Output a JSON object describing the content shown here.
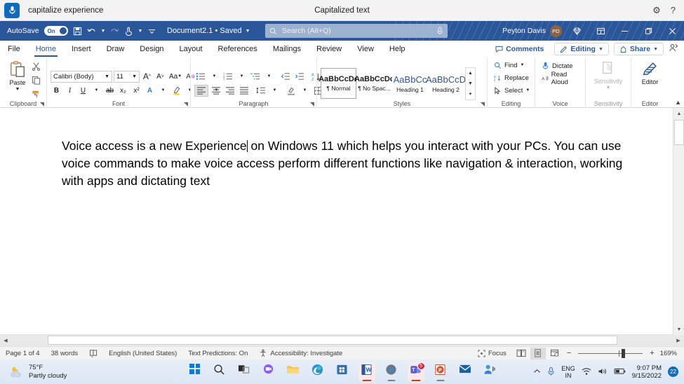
{
  "voice_access": {
    "mic_icon": "microphone-icon",
    "command_text": "capitalize experience",
    "status_text": "Capitalized text",
    "settings_icon": "gear-icon",
    "help_icon": "help-icon"
  },
  "titlebar": {
    "autosave_label": "AutoSave",
    "autosave_state": "On",
    "save_icon": "save-icon",
    "undo_icon": "undo-icon",
    "redo_icon": "redo-icon",
    "touch_icon": "touch-mode-icon",
    "customize_icon": "customize-qat-icon",
    "document_name": "Document2.1 • Saved",
    "search_placeholder": "Search (Alt+Q)",
    "search_icon": "search-icon",
    "search_mic_icon": "microphone-icon",
    "user_name": "Peyton Davis",
    "user_initials": "PD",
    "diamond_icon": "diamond-icon",
    "ribbon_display_icon": "ribbon-display-options-icon",
    "minimize_icon": "minimize-icon",
    "restore_icon": "restore-icon",
    "close_icon": "close-icon"
  },
  "ribbon": {
    "tabs": [
      {
        "label": "File",
        "active": false
      },
      {
        "label": "Home",
        "active": true
      },
      {
        "label": "Insert",
        "active": false
      },
      {
        "label": "Draw",
        "active": false
      },
      {
        "label": "Design",
        "active": false
      },
      {
        "label": "Layout",
        "active": false
      },
      {
        "label": "References",
        "active": false
      },
      {
        "label": "Mailings",
        "active": false
      },
      {
        "label": "Review",
        "active": false
      },
      {
        "label": "View",
        "active": false
      },
      {
        "label": "Help",
        "active": false
      }
    ],
    "comments_label": "Comments",
    "editing_label": "Editing",
    "share_label": "Share",
    "catchup_icon": "catch-up-icon",
    "collapse_icon": "collapse-ribbon-icon",
    "groups": {
      "clipboard": {
        "label": "Clipboard",
        "paste_label": "Paste",
        "cut_icon": "cut-icon",
        "copy_icon": "copy-icon",
        "format_painter_icon": "format-painter-icon"
      },
      "font": {
        "label": "Font",
        "font_name": "Calibri (Body)",
        "font_size": "11",
        "grow_icon": "increase-font-size-icon",
        "shrink_icon": "decrease-font-size-icon",
        "change_case_icon": "change-case-icon",
        "clear_formatting_icon": "clear-formatting-icon",
        "bold_label": "B",
        "italic_label": "I",
        "underline_label": "U",
        "strikethrough_icon": "strikethrough-icon",
        "subscript_label": "x₂",
        "superscript_label": "x²",
        "text_effects_icon": "text-effects-icon",
        "highlight_icon": "text-highlight-color-icon",
        "font_color_icon": "font-color-icon"
      },
      "paragraph": {
        "label": "Paragraph",
        "bullets_icon": "bullets-icon",
        "numbering_icon": "numbering-icon",
        "multilevel_icon": "multilevel-list-icon",
        "decrease_indent_icon": "decrease-indent-icon",
        "increase_indent_icon": "increase-indent-icon",
        "sort_icon": "sort-icon",
        "show_marks_icon": "show-formatting-marks-icon",
        "align_left_icon": "align-left-icon",
        "align_center_icon": "align-center-icon",
        "align_right_icon": "align-right-icon",
        "justify_icon": "justify-icon",
        "line_spacing_icon": "line-spacing-icon",
        "shading_icon": "shading-icon",
        "borders_icon": "borders-icon"
      },
      "styles": {
        "label": "Styles",
        "items": [
          {
            "preview": "AaBbCcDc",
            "name": "¶ Normal",
            "selected": true,
            "heading": false
          },
          {
            "preview": "AaBbCcDc",
            "name": "¶ No Spac...",
            "selected": false,
            "heading": false
          },
          {
            "preview": "AaBbCc",
            "name": "Heading 1",
            "selected": false,
            "heading": true
          },
          {
            "preview": "AaBbCcD",
            "name": "Heading 2",
            "selected": false,
            "heading": true
          }
        ],
        "scroll_up_icon": "scroll-up-icon",
        "scroll_down_icon": "scroll-down-icon",
        "more_icon": "more-styles-icon"
      },
      "editing": {
        "label": "Editing",
        "find_label": "Find",
        "replace_label": "Replace",
        "select_label": "Select",
        "find_icon": "find-icon",
        "replace_icon": "replace-icon",
        "select_icon": "select-icon"
      },
      "voice": {
        "label": "Voice",
        "dictate_label": "Dictate",
        "read_aloud_label": "Read Aloud",
        "dictate_icon": "microphone-icon",
        "read_aloud_icon": "read-aloud-icon"
      },
      "sensitivity": {
        "label": "Sensitivity",
        "button_label": "Sensitivity",
        "icon": "sensitivity-icon"
      },
      "editor": {
        "label": "Editor",
        "button_label": "Editor",
        "icon": "editor-pen-icon"
      }
    }
  },
  "document": {
    "paragraph_before_caret": "Voice access is a new Experience",
    "paragraph_after_caret": " on Windows 11 which helps you interact with your PCs. You can use voice commands to make voice access perform different functions like navigation & interaction, working with apps and dictating text"
  },
  "scrollbars": {
    "v_up_icon": "scroll-up-arrow-icon",
    "v_down_icon": "scroll-down-arrow-icon",
    "h_left_icon": "scroll-left-arrow-icon",
    "h_right_icon": "scroll-right-arrow-icon"
  },
  "statusbar": {
    "page": "Page 1 of 4",
    "words": "38 words",
    "proofing_icon": "proofing-errors-icon",
    "language": "English (United States)",
    "text_predictions": "Text Predictions: On",
    "accessibility": "Accessibility: Investigate",
    "accessibility_icon": "accessibility-icon",
    "focus_label": "Focus",
    "focus_icon": "focus-icon",
    "read_mode_icon": "read-mode-icon",
    "print_layout_icon": "print-layout-icon",
    "web_layout_icon": "web-layout-icon",
    "zoom_out_label": "−",
    "zoom_in_label": "+",
    "zoom_level": "169%"
  },
  "taskbar": {
    "weather_temp": "75°F",
    "weather_desc": "Partly cloudy",
    "weather_icon": "partly-cloudy-night-icon",
    "icons": [
      {
        "name": "start-button",
        "glyph": "windows-logo-icon"
      },
      {
        "name": "search-button",
        "glyph": "search-icon"
      },
      {
        "name": "task-view-button",
        "glyph": "task-view-icon"
      },
      {
        "name": "chat-button",
        "glyph": "chat-icon"
      },
      {
        "name": "file-explorer-button",
        "glyph": "folder-icon"
      },
      {
        "name": "edge-button",
        "glyph": "edge-icon"
      },
      {
        "name": "microsoft-store-button",
        "glyph": "store-icon"
      },
      {
        "name": "word-button",
        "glyph": "word-icon"
      },
      {
        "name": "settings-button",
        "glyph": "gear-icon"
      },
      {
        "name": "teams-button",
        "glyph": "teams-icon"
      },
      {
        "name": "powerpoint-button",
        "glyph": "powerpoint-icon"
      },
      {
        "name": "mail-button",
        "glyph": "mail-icon"
      },
      {
        "name": "voice-access-button",
        "glyph": "voice-access-icon"
      }
    ],
    "teams_badge": "5",
    "tray": {
      "show_hidden_icon": "chevron-up-icon",
      "mic_icon": "microphone-icon",
      "language_line1": "ENG",
      "language_line2": "IN",
      "wifi_icon": "wifi-icon",
      "volume_icon": "volume-icon",
      "battery_icon": "battery-icon",
      "time": "9:07 PM",
      "date": "9/15/2022",
      "notification_count": "22"
    }
  },
  "colors": {
    "word_blue": "#2b579a",
    "accent_blue": "#0f6cbd",
    "taskbar_bg": "#e6eef8"
  }
}
